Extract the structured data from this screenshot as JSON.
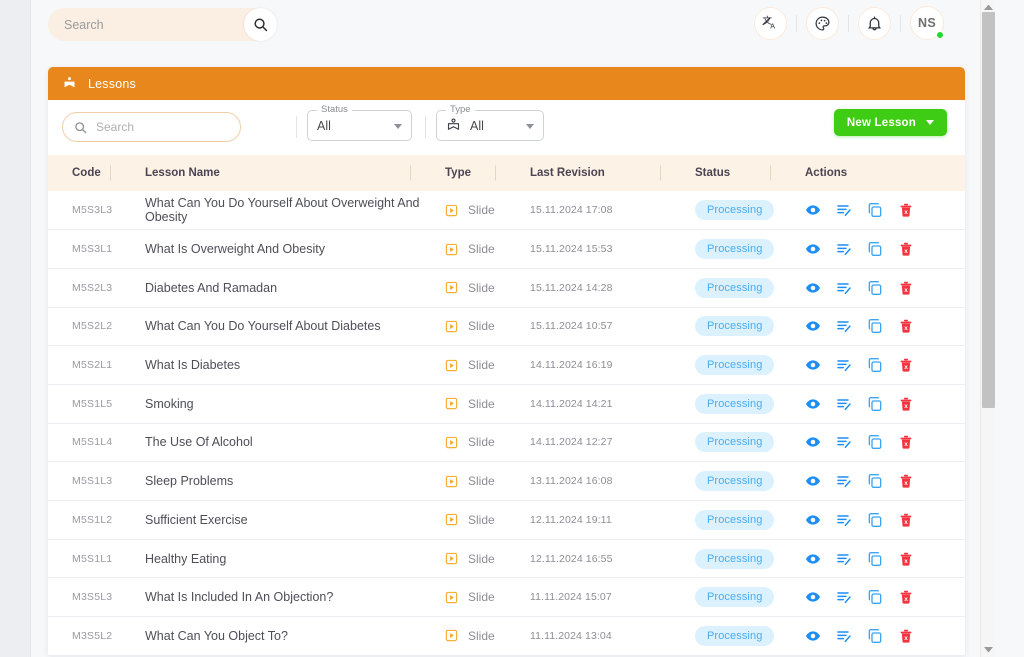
{
  "topbar": {
    "search": {
      "value": "",
      "placeholder": "Search"
    },
    "search_icon": "search-icon",
    "icons": [
      {
        "name": "translate-icon",
        "glyph": "translate"
      },
      {
        "name": "palette-icon",
        "glyph": "palette"
      },
      {
        "name": "bell-icon",
        "glyph": "bell"
      }
    ],
    "avatar": {
      "initials": "NS",
      "status": "online"
    }
  },
  "card": {
    "header": {
      "icon": "lessons-book-icon",
      "title": "Lessons"
    },
    "toolbar": {
      "search": {
        "value": "",
        "placeholder": "Search"
      },
      "status_filter": {
        "legend": "Status",
        "value": "All"
      },
      "type_filter": {
        "legend": "Type",
        "value": "All",
        "icon": "lessons-book-icon"
      },
      "new_lesson": {
        "label": "New Lesson"
      }
    },
    "table": {
      "columns": [
        "Code",
        "Lesson Name",
        "Type",
        "Last Revision",
        "Status",
        "Actions"
      ],
      "actions": [
        {
          "name": "view-icon",
          "label": "View"
        },
        {
          "name": "edit-icon",
          "label": "Edit"
        },
        {
          "name": "copy-icon",
          "label": "Duplicate"
        },
        {
          "name": "delete-icon",
          "label": "Delete"
        }
      ],
      "rows": [
        {
          "code": "M5S3L3",
          "name": "What Can You Do Yourself About Overweight And Obesity",
          "type": "Slide",
          "revision": "15.11.2024 17:08",
          "status": "Processing"
        },
        {
          "code": "M5S3L1",
          "name": "What Is Overweight And Obesity",
          "type": "Slide",
          "revision": "15.11.2024 15:53",
          "status": "Processing"
        },
        {
          "code": "M5S2L3",
          "name": "Diabetes And Ramadan",
          "type": "Slide",
          "revision": "15.11.2024 14:28",
          "status": "Processing"
        },
        {
          "code": "M5S2L2",
          "name": "What Can You Do Yourself About Diabetes",
          "type": "Slide",
          "revision": "15.11.2024 10:57",
          "status": "Processing"
        },
        {
          "code": "M5S2L1",
          "name": "What Is Diabetes",
          "type": "Slide",
          "revision": "14.11.2024 16:19",
          "status": "Processing"
        },
        {
          "code": "M5S1L5",
          "name": "Smoking",
          "type": "Slide",
          "revision": "14.11.2024 14:21",
          "status": "Processing"
        },
        {
          "code": "M5S1L4",
          "name": "The Use Of Alcohol",
          "type": "Slide",
          "revision": "14.11.2024 12:27",
          "status": "Processing"
        },
        {
          "code": "M5S1L3",
          "name": "Sleep Problems",
          "type": "Slide",
          "revision": "13.11.2024 16:08",
          "status": "Processing"
        },
        {
          "code": "M5S1L2",
          "name": "Sufficient Exercise",
          "type": "Slide",
          "revision": "12.11.2024 19:11",
          "status": "Processing"
        },
        {
          "code": "M5S1L1",
          "name": "Healthy Eating",
          "type": "Slide",
          "revision": "12.11.2024 16:55",
          "status": "Processing"
        },
        {
          "code": "M3S5L3",
          "name": "What Is Included In An Objection?",
          "type": "Slide",
          "revision": "11.11.2024 15:07",
          "status": "Processing"
        },
        {
          "code": "M3S5L2",
          "name": "What Can You Object To?",
          "type": "Slide",
          "revision": "11.11.2024 13:04",
          "status": "Processing"
        }
      ]
    }
  },
  "colors": {
    "brand_orange": "#e8871b",
    "accent_green": "#3fcc14",
    "status_blue": "#4bacf0",
    "status_blue_bg": "#dbf1fd",
    "action_blue": "#1d8ef5",
    "action_red": "#f5333f"
  }
}
